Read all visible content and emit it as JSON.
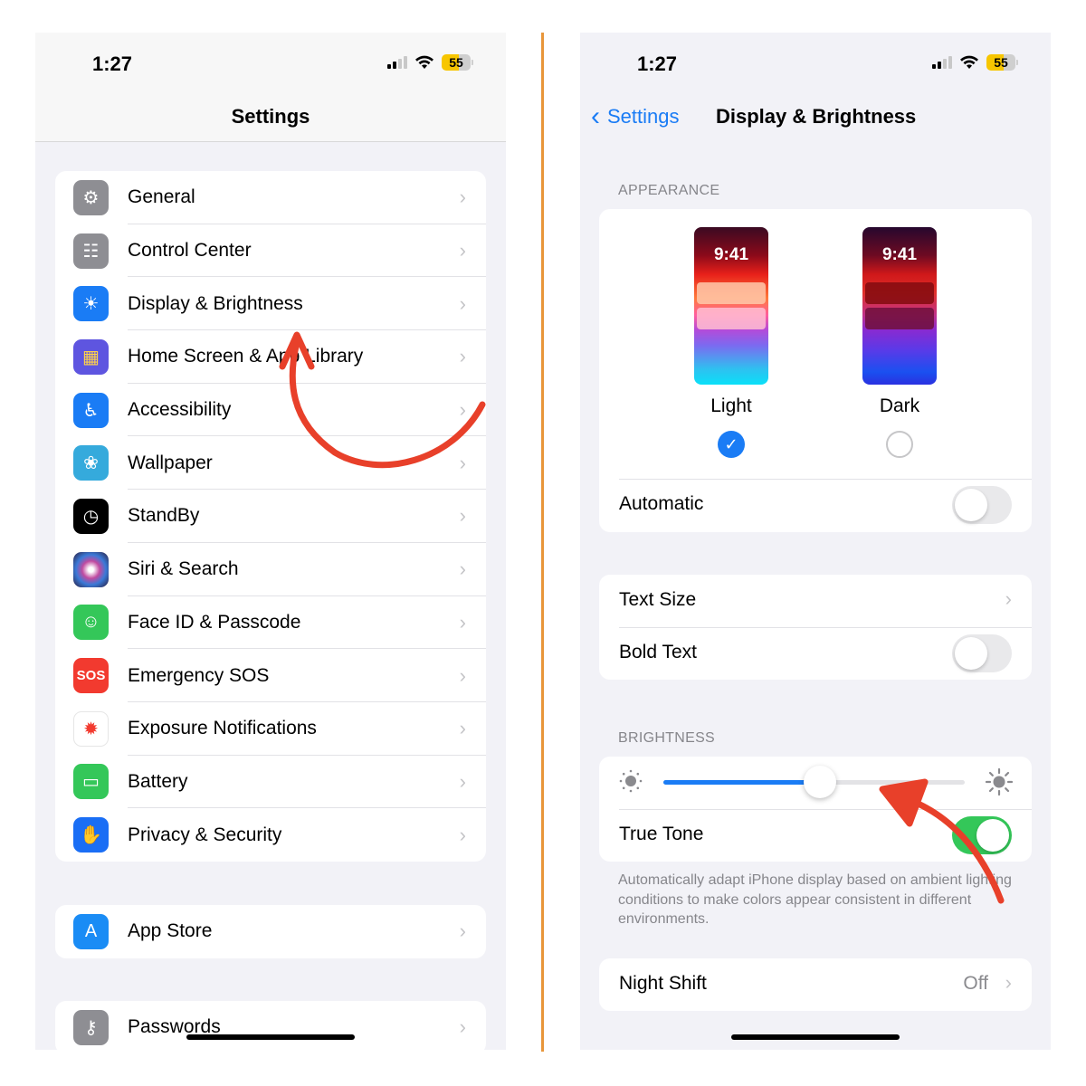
{
  "left_screen": {
    "status_bar": {
      "time": "1:27",
      "battery": "55",
      "signal_bars_on": 2,
      "signal_bars_total": 4
    },
    "title": "Settings",
    "groups": [
      {
        "items": [
          {
            "label": "General",
            "icon": "gear-icon",
            "color": "#8e8e93"
          },
          {
            "label": "Control Center",
            "icon": "switches-icon",
            "color": "#8e8e93"
          },
          {
            "label": "Display & Brightness",
            "icon": "sun-icon",
            "color": "#1a7cf5"
          },
          {
            "label": "Home Screen & App Library",
            "icon": "app-grid-icon",
            "color": "#5e55e0"
          },
          {
            "label": "Accessibility",
            "icon": "accessibility-icon",
            "color": "#1a7cf5"
          },
          {
            "label": "Wallpaper",
            "icon": "flower-icon",
            "color": "#35aadc"
          },
          {
            "label": "StandBy",
            "icon": "standby-icon",
            "color": "#000000"
          },
          {
            "label": "Siri & Search",
            "icon": "siri-icon",
            "color": "#2a1a3a"
          },
          {
            "label": "Face ID & Passcode",
            "icon": "face-id-icon",
            "color": "#34c759"
          },
          {
            "label": "Emergency SOS",
            "icon": "sos-icon",
            "color": "#f23a2f"
          },
          {
            "label": "Exposure Notifications",
            "icon": "exposure-icon",
            "color": "#ffffff"
          },
          {
            "label": "Battery",
            "icon": "battery-icon",
            "color": "#34c759"
          },
          {
            "label": "Privacy & Security",
            "icon": "hand-icon",
            "color": "#1a6ef5"
          }
        ]
      },
      {
        "items": [
          {
            "label": "App Store",
            "icon": "app-store-icon",
            "color": "#1a8cf5"
          }
        ]
      },
      {
        "items": [
          {
            "label": "Passwords",
            "icon": "key-icon",
            "color": "#8e8e93"
          }
        ]
      }
    ]
  },
  "right_screen": {
    "status_bar": {
      "time": "1:27",
      "battery": "55"
    },
    "back_label": "Settings",
    "title": "Display & Brightness",
    "appearance": {
      "header": "APPEARANCE",
      "preview_time": "9:41",
      "options": [
        {
          "label": "Light",
          "selected": true
        },
        {
          "label": "Dark",
          "selected": false
        }
      ],
      "automatic_label": "Automatic",
      "automatic_on": false
    },
    "text": {
      "text_size_label": "Text Size",
      "bold_text_label": "Bold Text",
      "bold_text_on": false
    },
    "brightness": {
      "header": "BRIGHTNESS",
      "level_percent": 52,
      "true_tone_label": "True Tone",
      "true_tone_on": true,
      "footnote": "Automatically adapt iPhone display based on ambient lighting conditions to make colors appear consistent in different environments."
    },
    "night_shift": {
      "label": "Night Shift",
      "value": "Off"
    }
  },
  "annotations": {
    "arrow_color": "#e8402a"
  },
  "glyphs": {
    "chevron": "›",
    "back_chevron": "‹",
    "check": "✓"
  }
}
